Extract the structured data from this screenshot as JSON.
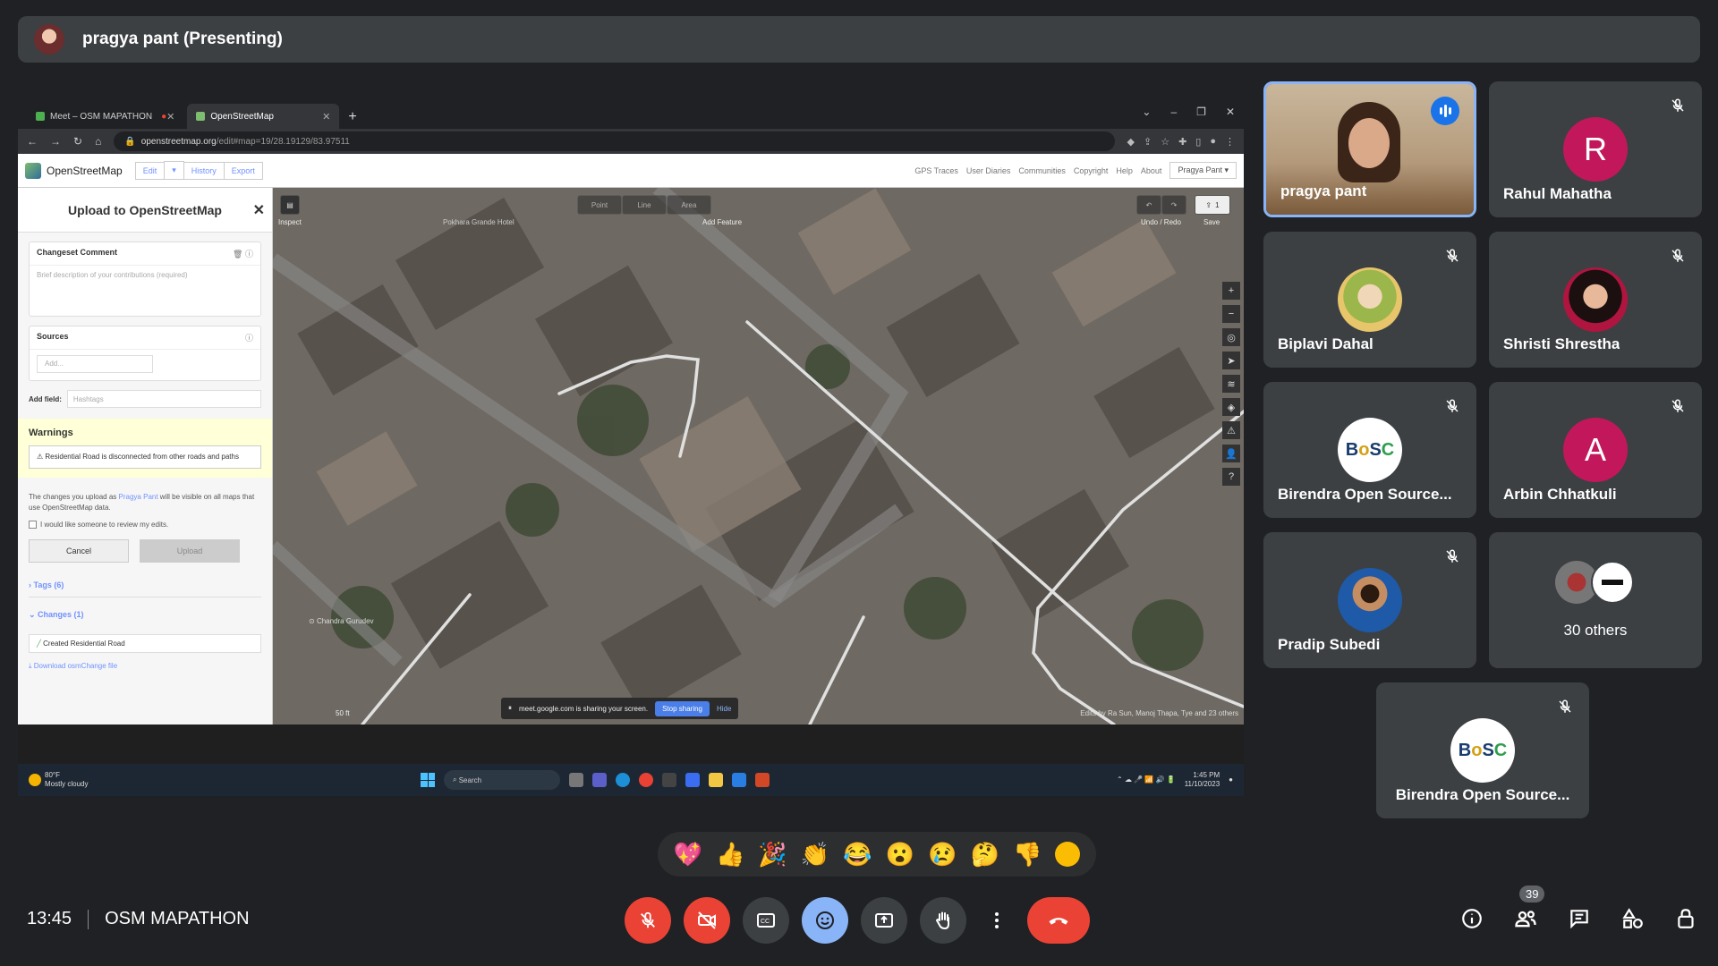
{
  "presenter": {
    "name": "pragya pant (Presenting)"
  },
  "browser": {
    "tabs": [
      {
        "label": "Meet – OSM MAPATHON"
      },
      {
        "label": "OpenStreetMap"
      }
    ],
    "url_main": "openstreetmap.org",
    "url_rest": "/edit#map=19/28.19129/83.97511"
  },
  "osm": {
    "brand": "OpenStreetMap",
    "buttons": [
      "Edit",
      "History",
      "Export"
    ],
    "nav": [
      "GPS Traces",
      "User Diaries",
      "Communities",
      "Copyright",
      "Help",
      "About"
    ],
    "user": "Pragya Pant",
    "panel": {
      "title": "Upload to OpenStreetMap",
      "changeset_label": "Changeset Comment",
      "changeset_placeholder": "Brief description of your contributions (required)",
      "sources_label": "Sources",
      "sources_placeholder": "Add...",
      "addfield_label": "Add field:",
      "addfield_placeholder": "Hashtags",
      "warnings_title": "Warnings",
      "warning_text": "Residential Road is disconnected from other roads and paths",
      "note_pre": "The changes you upload as",
      "note_user": "Pragya Pant",
      "note_post": "will be visible on all maps that use OpenStreetMap data.",
      "review_label": "I would like someone to review my edits.",
      "cancel": "Cancel",
      "upload": "Upload",
      "tags": "Tags (6)",
      "changes": "Changes (1)",
      "change_item": "Created Residential Road",
      "download": "Download osmChange file"
    },
    "map": {
      "inspect": "Inspect",
      "add_feature": "Add Feature",
      "modes": [
        "Point",
        "Line",
        "Area"
      ],
      "undo_redo": "Undo / Redo",
      "save": "Save",
      "save_count": "1",
      "place1": "Pokhara Grande Hotel",
      "place2": "Chandra Gurudev",
      "scale": "50 ft",
      "share_text": "meet.google.com is sharing your screen.",
      "stop_sharing": "Stop sharing",
      "hide": "Hide",
      "attribution": "Edits by Ra Sun, Manoj Thapa, Tye and 23 others"
    }
  },
  "taskbar": {
    "temp": "80°F",
    "weather": "Mostly cloudy",
    "search": "Search",
    "time": "1:45 PM",
    "date": "11/10/2023"
  },
  "participants": [
    {
      "name": "pragya pant"
    },
    {
      "name": "Rahul Mahatha",
      "letter": "R",
      "color": "#c2185b"
    },
    {
      "name": "Biplavi Dahal"
    },
    {
      "name": "Shristi Shrestha"
    },
    {
      "name": "Birendra Open Source..."
    },
    {
      "name": "Arbin Chhatkuli",
      "letter": "A",
      "color": "#c2185b"
    },
    {
      "name": "Pradip Subedi"
    },
    {
      "name": "30 others"
    },
    {
      "name": "Birendra Open Source..."
    }
  ],
  "reactions": [
    "💖",
    "👍",
    "🎉",
    "👏",
    "😂",
    "😮",
    "😢",
    "🤔",
    "👎"
  ],
  "meeting": {
    "time": "13:45",
    "name": "OSM MAPATHON",
    "participant_count": "39"
  }
}
